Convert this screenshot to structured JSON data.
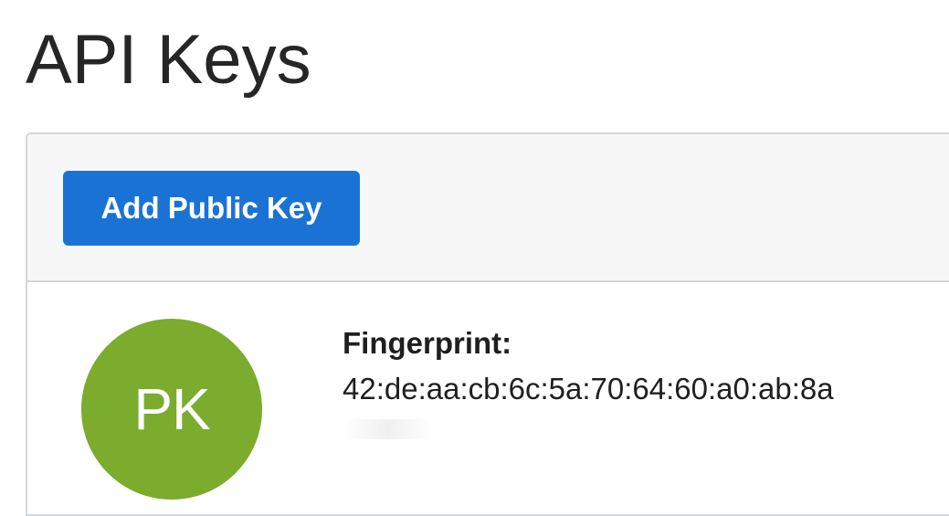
{
  "page": {
    "title": "API Keys"
  },
  "toolbar": {
    "add_button_label": "Add Public Key"
  },
  "keys": [
    {
      "avatar_initials": "PK",
      "avatar_color": "#7bac2e",
      "fingerprint_label": "Fingerprint:",
      "fingerprint_value": "42:de:aa:cb:6c:5a:70:64:60:a0:ab:8a"
    }
  ],
  "colors": {
    "primary_button": "#1a73d4",
    "toolbar_background": "#f7f7f7",
    "panel_border": "#d4d7db"
  }
}
